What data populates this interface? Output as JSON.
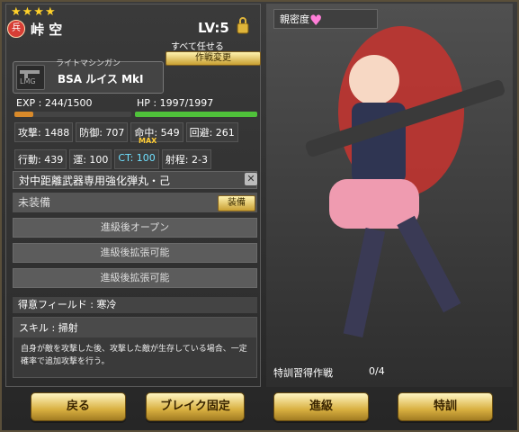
{
  "character": {
    "stars": "★★★★",
    "rank_badge": "兵",
    "name": "峠 空",
    "level": "LV:5",
    "auto_label": "すべて任せる",
    "strategy_button": "作戦変更"
  },
  "weapon": {
    "type": "ライトマシンガン",
    "icon_label": "LMG",
    "name": "BSA ルイス MkI"
  },
  "exp": {
    "text": "EXP : 244/1500",
    "fraction": 0.163
  },
  "hp": {
    "text": "HP : 1997/1997",
    "fraction": 1.0
  },
  "stats": {
    "row1": [
      "攻撃: 1488",
      "防御: 707",
      "命中: 549",
      "回避: 261"
    ],
    "row2": [
      "行動: 439",
      "運: 100",
      "CT: 100",
      "射程: 2-3"
    ],
    "max_tag": "MAX"
  },
  "equipment": {
    "header": "対中距離武器専用強化弾丸・己",
    "close_icon": "✕",
    "unequipped": "未装備",
    "equip_button": "装備",
    "slots": [
      "進級後オープン",
      "進級後拡張可能",
      "進級後拡張可能"
    ]
  },
  "field": "得意フィールド : 寒冷",
  "skill": {
    "title": "スキル : 掃射",
    "desc": "自身が敵を攻撃した後、攻撃した敵が生存している場合、一定確率で追加攻撃を行う。"
  },
  "affinity_label": "親密度",
  "training": {
    "label": "特訓習得作戦",
    "count": "0/4"
  },
  "buttons": [
    "戻る",
    "ブレイク固定",
    "進級",
    "特訓"
  ],
  "colors": {
    "exp_bar": "#d98a2a",
    "hp_bar": "#4fc13a",
    "accent_gold": "#d9b040",
    "heart": "#ff7ed8"
  }
}
